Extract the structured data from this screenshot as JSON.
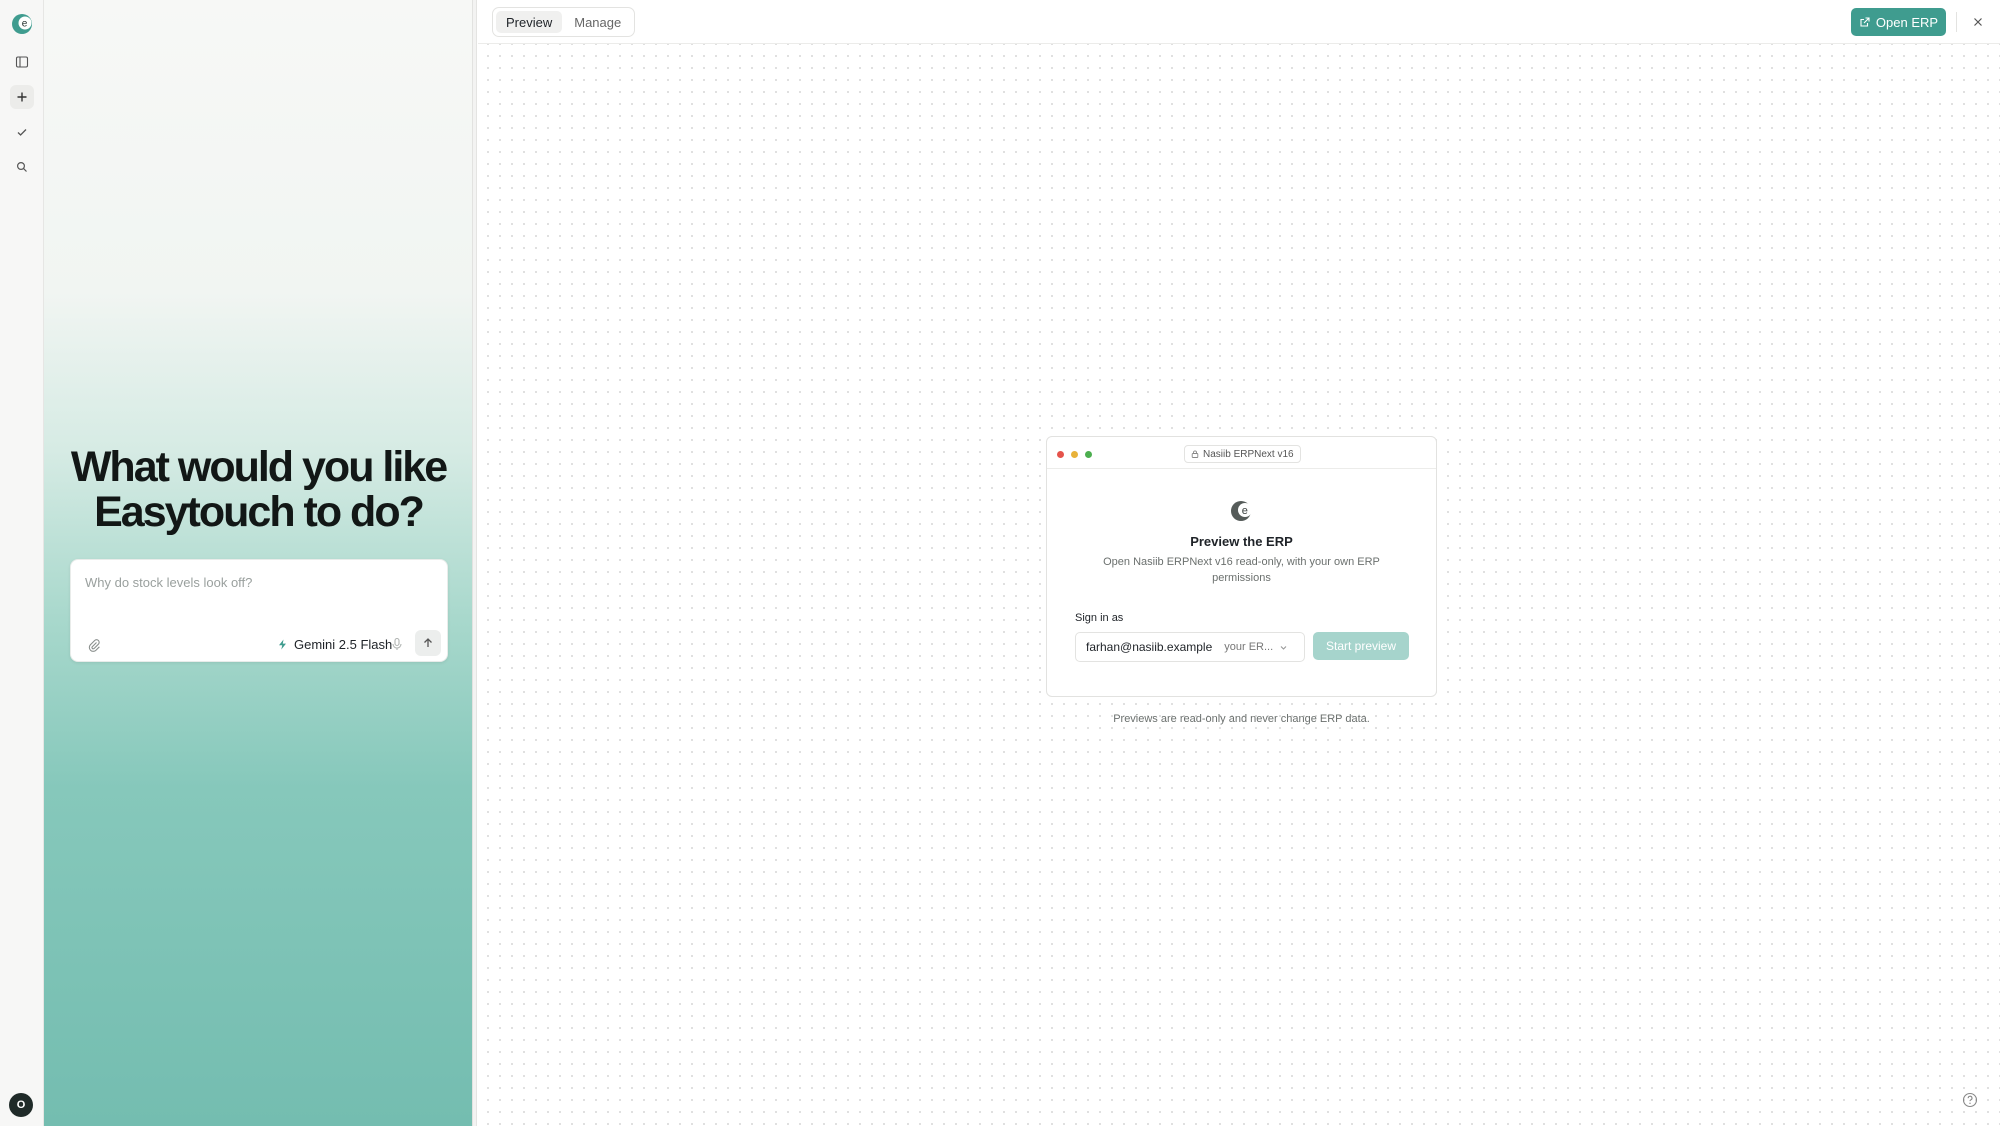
{
  "rail": {
    "logo_icon": "easytouch-logo-icon",
    "items": [
      "sidebar-toggle-icon",
      "plus-icon",
      "check-icon",
      "search-icon"
    ],
    "avatar_initial": "O"
  },
  "chat": {
    "headline_line1": "What would you like",
    "headline_line2": "Easytouch to do?",
    "input_placeholder": "Why do stock levels look off?",
    "model_label": "Gemini 2.5 Flash"
  },
  "preview": {
    "tabs": [
      {
        "label": "Preview",
        "active": true
      },
      {
        "label": "Manage",
        "active": false
      }
    ],
    "open_erp_label": "Open ERP",
    "accent_color": "#3f9c8f",
    "card": {
      "url_label": "Nasiib ERPNext v16",
      "title": "Preview the ERP",
      "subtitle": "Open Nasiib ERPNext v16 read-only, with your own ERP permissions",
      "sign_in_label": "Sign in as",
      "selected_email": "farhan@nasiib.example",
      "selected_role": "your ER...",
      "start_button": "Start preview"
    },
    "footnote": "Previews are read-only and never change ERP data."
  }
}
